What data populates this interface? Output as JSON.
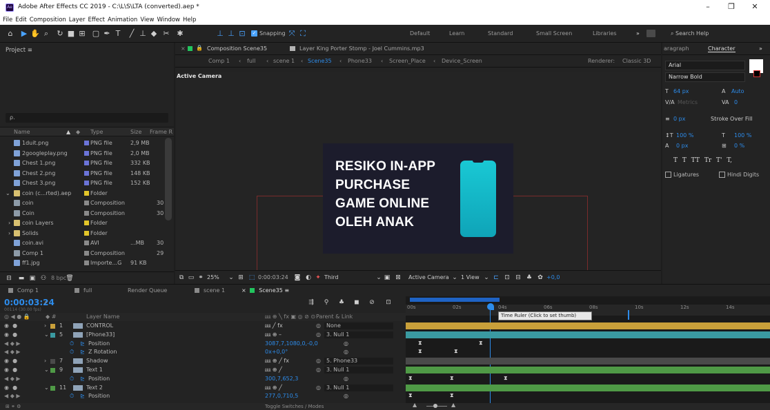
{
  "window": {
    "title": "Adobe After Effects CC 2019 - C:\\L\\S\\LTA (converted).aep *",
    "app_icon": "Ae"
  },
  "menu": [
    "File",
    "Edit",
    "Composition",
    "Layer",
    "Effect",
    "Animation",
    "View",
    "Window",
    "Help"
  ],
  "toolbar": {
    "snapping": "Snapping",
    "workspaces": [
      "Default",
      "Learn",
      "Standard",
      "Small Screen",
      "Libraries"
    ],
    "overflow": "»",
    "search": "Search Help"
  },
  "project": {
    "title": "Project",
    "menu_icon": "≡",
    "search_placeholder": "ρ.",
    "columns": [
      "Name",
      "Type",
      "Size",
      "Frame R"
    ],
    "items": [
      {
        "name": "1duit.png",
        "type": "PNG file",
        "size": "2,9 MB",
        "frame": "",
        "color": "#6b74d8"
      },
      {
        "name": "2googleplay.png",
        "type": "PNG file",
        "size": "2,0 MB",
        "frame": "",
        "color": "#6b74d8"
      },
      {
        "name": "Chest 1.png",
        "type": "PNG file",
        "size": "332 KB",
        "frame": "",
        "color": "#6b74d8"
      },
      {
        "name": "Chest 2.png",
        "type": "PNG file",
        "size": "148 KB",
        "frame": "",
        "color": "#6b74d8"
      },
      {
        "name": "Chest 3.png",
        "type": "PNG file",
        "size": "152 KB",
        "frame": "",
        "color": "#6b74d8"
      },
      {
        "name": "coin (c...rted).aep",
        "type": "Folder",
        "size": "",
        "frame": "",
        "color": "#e3c62a"
      },
      {
        "name": "coin",
        "type": "Composition",
        "size": "",
        "frame": "30",
        "color": "#8a8a8a"
      },
      {
        "name": "Coin",
        "type": "Composition",
        "size": "",
        "frame": "30",
        "color": "#8a8a8a"
      },
      {
        "name": "coin Layers",
        "type": "Folder",
        "size": "",
        "frame": "",
        "color": "#e3c62a"
      },
      {
        "name": "Solids",
        "type": "Folder",
        "size": "",
        "frame": "",
        "color": "#e3c62a"
      },
      {
        "name": "coin.avi",
        "type": "AVI",
        "size": "...MB",
        "frame": "30",
        "color": "#8a8a8a"
      },
      {
        "name": "Comp 1",
        "type": "Composition",
        "size": "",
        "frame": "29",
        "color": "#8a8a8a"
      },
      {
        "name": "ff1.jpg",
        "type": "Importe...G",
        "size": "91 KB",
        "frame": "",
        "color": "#8a8a8a"
      }
    ],
    "footer_bpc": "8 bpc"
  },
  "comp_panel": {
    "tab_comp": "Composition Scene35",
    "tab_layer": "Layer King Porter Stomp - Joel Cummins.mp3",
    "breadcrumbs": [
      "Comp 1",
      "full",
      "scene 1",
      "Scene35",
      "Phone33",
      "Screen_Place",
      "Device_Screen"
    ],
    "renderer_label": "Renderer:",
    "renderer": "Classic 3D",
    "active_camera": "Active Camera",
    "slide_lines": [
      "RESIKO IN-APP",
      "PURCHASE",
      "GAME ONLINE",
      "OLEH ANAK"
    ],
    "footer": {
      "zoom": "25%",
      "timecode": "0:00:03:24",
      "resolution": "Third",
      "view": "Active Camera",
      "views": "1 View",
      "exposure": "+0,0"
    }
  },
  "char_panel": {
    "tab_paragraph": "aragraph",
    "tab_character": "Character",
    "font": "Arial",
    "style": "Narrow Bold",
    "size": "64 px",
    "leading": "Auto",
    "kerning": "Metrics",
    "tracking": "0",
    "stroke_width": "0 px",
    "stroke_mode": "Stroke Over Fill",
    "vscale": "100 %",
    "hscale": "100 %",
    "baseline": "0 px",
    "tsume": "0 %",
    "formats": [
      "T",
      "T",
      "TT",
      "Tr",
      "T'",
      "T,"
    ],
    "ligatures": "Ligatures",
    "hindi": "Hindi Digits"
  },
  "tabs": [
    {
      "label": "Comp 1",
      "color": "#8a8a8a"
    },
    {
      "label": "full",
      "color": "#8a8a8a"
    },
    {
      "label": "Render Queue",
      "color": ""
    },
    {
      "label": "scene 1",
      "color": "#8a8a8a"
    },
    {
      "label": "Scene35",
      "color": "#22c55e"
    }
  ],
  "timeline": {
    "timecode": "0:00:03:24",
    "fps": "00114 (30.00 fps)",
    "col_layer": "Layer Name",
    "col_parent": "Parent & Link",
    "toggle": "Toggle Switches / Modes",
    "tooltip": "Time Ruler (Click to set thumb)",
    "ruler": [
      "00s",
      "02s",
      "04s",
      "06s",
      "08s",
      "10s",
      "12s",
      "14s"
    ],
    "layers": [
      {
        "num": "1",
        "name": "CONTROL",
        "switches": "⅏ ╱ fx",
        "parent": "None",
        "color": "#c9a03a",
        "prop": false
      },
      {
        "num": "5",
        "name": "[Phone33]",
        "switches": "⅏ ⊕ –",
        "parent": "3. Null 1",
        "color": "#3a9aa1",
        "prop": false
      },
      {
        "num": "",
        "name": "Position",
        "switches": "",
        "parent": "",
        "value": "3087,7,1080,0,-0,0",
        "prop": true
      },
      {
        "num": "",
        "name": "Z Rotation",
        "switches": "",
        "parent": "",
        "value": "0x+0,0°",
        "prop": true
      },
      {
        "num": "7",
        "name": "Shadow",
        "switches": "⅏ ⊕ ╱ fx",
        "parent": "5. Phone33",
        "color": "#4a4a4a",
        "prop": false
      },
      {
        "num": "9",
        "name": "Text 1",
        "switches": "⅏ ⊕ ╱",
        "parent": "3. Null 1",
        "color": "#4f9a46",
        "prop": false
      },
      {
        "num": "",
        "name": "Position",
        "switches": "",
        "parent": "",
        "value": "300,7,652,3",
        "prop": true
      },
      {
        "num": "11",
        "name": "Text 2",
        "switches": "⅏ ⊕ ╱",
        "parent": "3. Null 1",
        "color": "#4f9a46",
        "prop": false
      },
      {
        "num": "",
        "name": "Position",
        "switches": "",
        "parent": "",
        "value": "277,0,710,5",
        "prop": true
      }
    ]
  }
}
